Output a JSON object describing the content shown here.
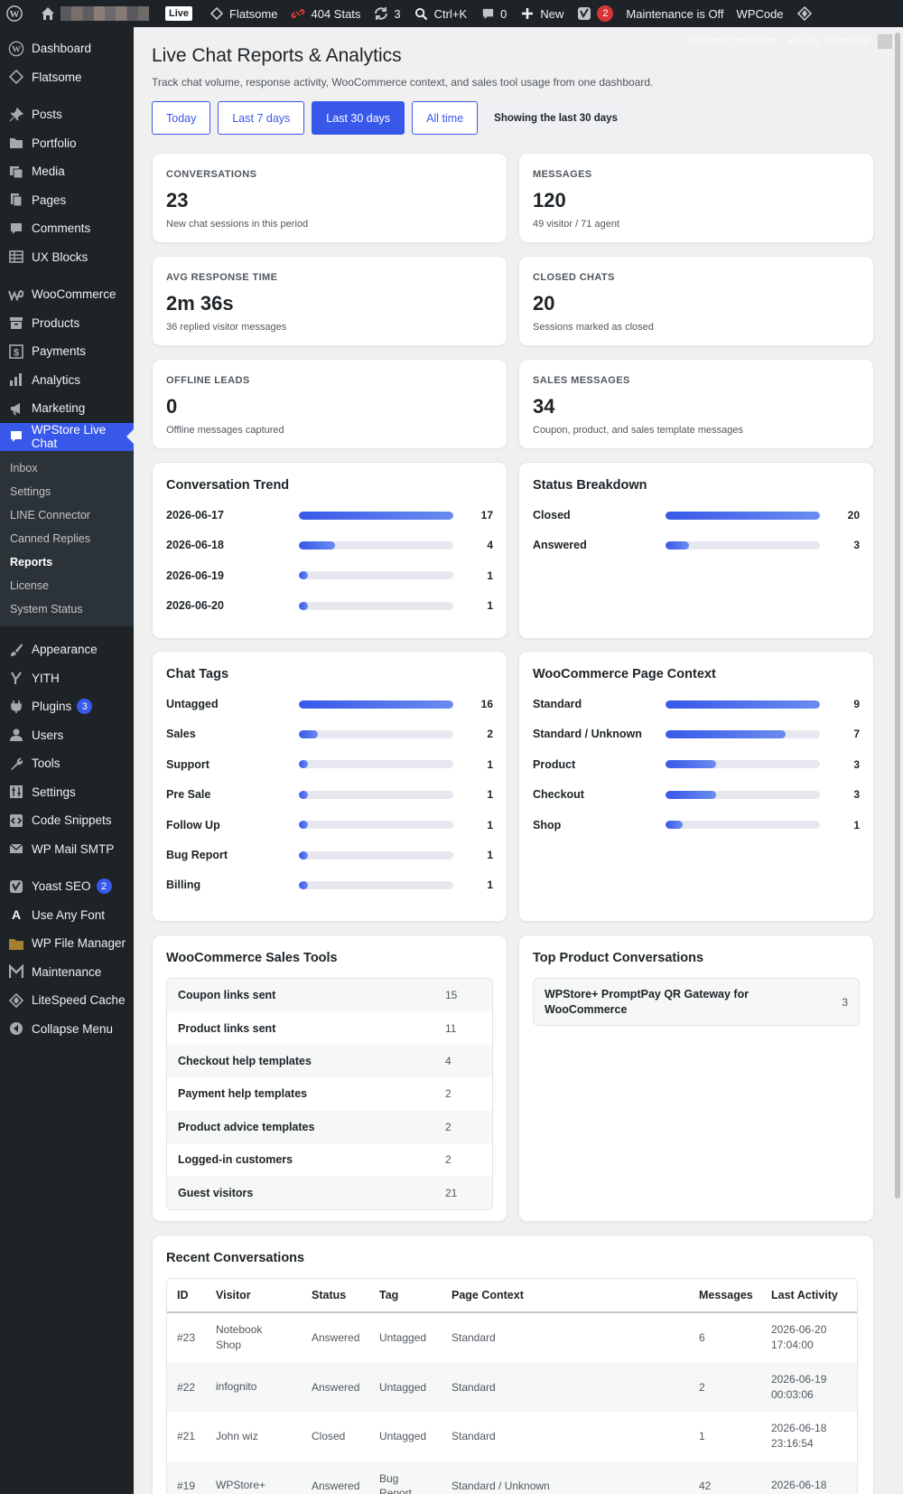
{
  "admin_bar": {
    "live": "Live",
    "flatsome": "Flatsome",
    "stats": "404 Stats",
    "updates_count": "3",
    "search": "Ctrl+K",
    "comments_count": "0",
    "new": "New",
    "yoast_count": "2",
    "maintenance": "Maintenance is Off",
    "wpcode": "WPCode",
    "right_suspend": "Suspend Transients",
    "right_howdy": "Howdy, avataruser"
  },
  "sidebar": {
    "items": [
      {
        "label": "Dashboard",
        "icon": "dashboard-icon"
      },
      {
        "label": "Flatsome",
        "icon": "flatsome-icon"
      },
      {
        "label": "Posts",
        "icon": "pin-icon"
      },
      {
        "label": "Portfolio",
        "icon": "folder-icon"
      },
      {
        "label": "Media",
        "icon": "media-icon"
      },
      {
        "label": "Pages",
        "icon": "pages-icon"
      },
      {
        "label": "Comments",
        "icon": "comment-icon"
      },
      {
        "label": "UX Blocks",
        "icon": "blocks-icon"
      },
      {
        "label": "WooCommerce",
        "icon": "woo-icon"
      },
      {
        "label": "Products",
        "icon": "archive-icon"
      },
      {
        "label": "Payments",
        "icon": "dollar-icon"
      },
      {
        "label": "Analytics",
        "icon": "chart-icon"
      },
      {
        "label": "Marketing",
        "icon": "megaphone-icon"
      },
      {
        "label": "WPStore Live Chat",
        "icon": "chat-icon"
      },
      {
        "label": "Appearance",
        "icon": "brush-icon"
      },
      {
        "label": "YITH",
        "icon": "yith-icon"
      },
      {
        "label": "Plugins",
        "icon": "plug-icon",
        "badge": "3"
      },
      {
        "label": "Users",
        "icon": "user-icon"
      },
      {
        "label": "Tools",
        "icon": "wrench-icon"
      },
      {
        "label": "Settings",
        "icon": "settings-icon"
      },
      {
        "label": "Code Snippets",
        "icon": "code-icon"
      },
      {
        "label": "WP Mail SMTP",
        "icon": "mail-icon"
      },
      {
        "label": "Yoast SEO",
        "icon": "yoast-icon",
        "badge": "2"
      },
      {
        "label": "Use Any Font",
        "icon": "font-icon"
      },
      {
        "label": "WP File Manager",
        "icon": "file-manager-icon"
      },
      {
        "label": "Maintenance",
        "icon": "maintenance-icon"
      },
      {
        "label": "LiteSpeed Cache",
        "icon": "litespeed-icon"
      },
      {
        "label": "Collapse Menu",
        "icon": "collapse-icon"
      }
    ],
    "submenu": [
      "Inbox",
      "Settings",
      "LINE Connector",
      "Canned Replies",
      "Reports",
      "License",
      "System Status"
    ]
  },
  "page": {
    "title": "Live Chat Reports & Analytics",
    "description": "Track chat volume, response activity, WooCommerce context, and sales tool usage from one dashboard.",
    "filters": [
      "Today",
      "Last 7 days",
      "Last 30 days",
      "All time"
    ],
    "active_filter": "Last 30 days",
    "filter_note": "Showing the last 30 days"
  },
  "stats": [
    {
      "label": "CONVERSATIONS",
      "value": "23",
      "sub": "New chat sessions in this period"
    },
    {
      "label": "MESSAGES",
      "value": "120",
      "sub": "49 visitor / 71 agent"
    },
    {
      "label": "AVG RESPONSE TIME",
      "value": "2m 36s",
      "sub": "36 replied visitor messages"
    },
    {
      "label": "CLOSED CHATS",
      "value": "20",
      "sub": "Sessions marked as closed"
    },
    {
      "label": "OFFLINE LEADS",
      "value": "0",
      "sub": "Offline messages captured"
    },
    {
      "label": "SALES MESSAGES",
      "value": "34",
      "sub": "Coupon, product, and sales template messages"
    }
  ],
  "trend": {
    "title": "Conversation Trend",
    "rows": [
      {
        "label": "2026-06-17",
        "count": "17",
        "fraction": 1.0
      },
      {
        "label": "2026-06-18",
        "count": "4",
        "fraction": 0.235
      },
      {
        "label": "2026-06-19",
        "count": "1",
        "fraction": 0.06
      },
      {
        "label": "2026-06-20",
        "count": "1",
        "fraction": 0.06
      }
    ]
  },
  "status": {
    "title": "Status Breakdown",
    "rows": [
      {
        "label": "Closed",
        "count": "20",
        "fraction": 1.0
      },
      {
        "label": "Answered",
        "count": "3",
        "fraction": 0.15
      }
    ]
  },
  "tags": {
    "title": "Chat Tags",
    "rows": [
      {
        "label": "Untagged",
        "count": "16",
        "fraction": 1.0
      },
      {
        "label": "Sales",
        "count": "2",
        "fraction": 0.125
      },
      {
        "label": "Support",
        "count": "1",
        "fraction": 0.06
      },
      {
        "label": "Pre Sale",
        "count": "1",
        "fraction": 0.06
      },
      {
        "label": "Follow Up",
        "count": "1",
        "fraction": 0.06
      },
      {
        "label": "Bug Report",
        "count": "1",
        "fraction": 0.06
      },
      {
        "label": "Billing",
        "count": "1",
        "fraction": 0.06
      }
    ]
  },
  "context": {
    "title": "WooCommerce Page Context",
    "rows": [
      {
        "label": "Standard",
        "count": "9",
        "fraction": 1.0
      },
      {
        "label": "Standard / Unknown",
        "count": "7",
        "fraction": 0.78
      },
      {
        "label": "Product",
        "count": "3",
        "fraction": 0.33
      },
      {
        "label": "Checkout",
        "count": "3",
        "fraction": 0.33
      },
      {
        "label": "Shop",
        "count": "1",
        "fraction": 0.11
      }
    ]
  },
  "sales_tools": {
    "title": "WooCommerce Sales Tools",
    "rows": [
      {
        "label": "Coupon links sent",
        "value": "15"
      },
      {
        "label": "Product links sent",
        "value": "11"
      },
      {
        "label": "Checkout help templates",
        "value": "4"
      },
      {
        "label": "Payment help templates",
        "value": "2"
      },
      {
        "label": "Product advice templates",
        "value": "2"
      },
      {
        "label": "Logged-in customers",
        "value": "2"
      },
      {
        "label": "Guest visitors",
        "value": "21"
      }
    ]
  },
  "top_products": {
    "title": "Top Product Conversations",
    "rows": [
      {
        "name_line1": "WPStore+ PromptPay QR Gateway for",
        "name_line2": "WooCommerce",
        "count": "3"
      }
    ]
  },
  "recent": {
    "title": "Recent Conversations",
    "headers": [
      "ID",
      "Visitor",
      "Status",
      "Tag",
      "Page Context",
      "Messages",
      "Last Activity"
    ],
    "rows": [
      {
        "id": "#23",
        "visitor1": "Notebook",
        "visitor2": "Shop",
        "status": "Answered",
        "tag1": "Untagged",
        "tag2": "",
        "context": "Standard",
        "messages": "6",
        "date": "2026-06-20",
        "time": "17:04:00"
      },
      {
        "id": "#22",
        "visitor1": "infognito",
        "visitor2": "",
        "status": "Answered",
        "tag1": "Untagged",
        "tag2": "",
        "context": "Standard",
        "messages": "2",
        "date": "2026-06-19",
        "time": "00:03:06"
      },
      {
        "id": "#21",
        "visitor1": "John wiz",
        "visitor2": "",
        "status": "Closed",
        "tag1": "Untagged",
        "tag2": "",
        "context": "Standard",
        "messages": "1",
        "date": "2026-06-18",
        "time": "23:16:54"
      },
      {
        "id": "#19",
        "visitor1": "WPStore+",
        "visitor2": "",
        "status": "Answered",
        "tag1": "Bug",
        "tag2": "Report",
        "context": "Standard / Unknown",
        "messages": "42",
        "date": "2026-06-18",
        "time": ""
      }
    ]
  }
}
